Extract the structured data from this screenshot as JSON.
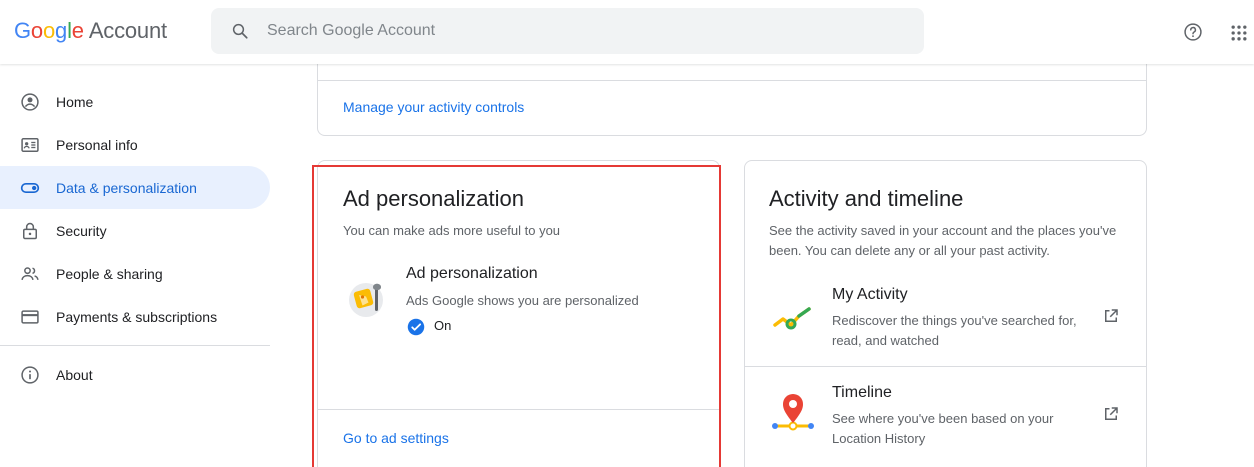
{
  "header": {
    "logo": {
      "g": "G",
      "o1": "o",
      "o2": "o",
      "g2": "g",
      "l": "l",
      "e": "e",
      "account": "Account"
    },
    "search_placeholder": "Search Google Account"
  },
  "sidebar": {
    "items": [
      {
        "label": "Home",
        "icon": "account-circle-icon"
      },
      {
        "label": "Personal info",
        "icon": "id-card-icon"
      },
      {
        "label": "Data & personalization",
        "icon": "toggle-icon"
      },
      {
        "label": "Security",
        "icon": "lock-icon"
      },
      {
        "label": "People & sharing",
        "icon": "people-icon"
      },
      {
        "label": "Payments & subscriptions",
        "icon": "credit-card-icon"
      }
    ],
    "about": {
      "label": "About",
      "icon": "info-icon"
    }
  },
  "top_card": {
    "link": "Manage your activity controls"
  },
  "ad_card": {
    "title": "Ad personalization",
    "description": "You can make ads more useful to you",
    "item_title": "Ad personalization",
    "item_desc": "Ads Google shows you are personalized",
    "status": "On",
    "link": "Go to ad settings"
  },
  "activity_card": {
    "title": "Activity and timeline",
    "description": "See the activity saved in your account and the places you've been. You can delete any or all your past activity.",
    "items": [
      {
        "title": "My Activity",
        "desc": "Rediscover the things you've searched for, read, and watched"
      },
      {
        "title": "Timeline",
        "desc": "See where you've been based on your Location History"
      }
    ]
  },
  "colors": {
    "accent": "#1a73e8",
    "active_bg": "#e8f0fe",
    "highlight": "#e53935",
    "divider": "#dadce0"
  }
}
